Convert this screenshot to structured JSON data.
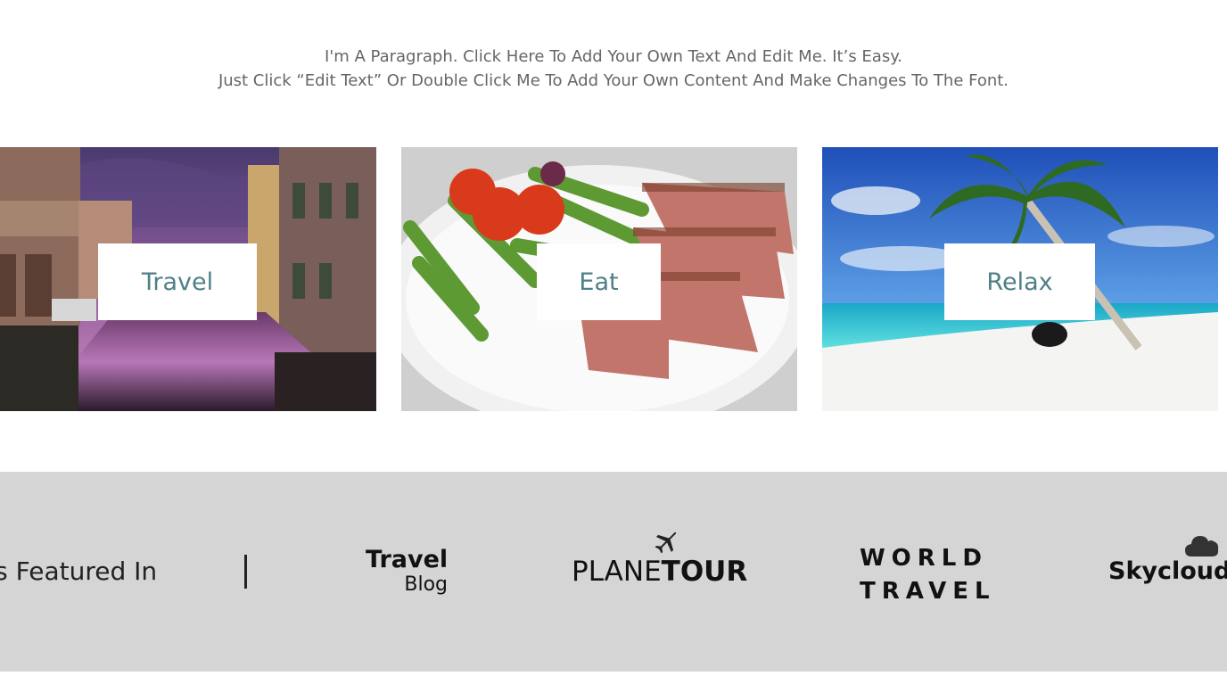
{
  "intro": {
    "line1": "I'm A Paragraph. Click Here To Add Your Own Text And Edit Me. It’s Easy.",
    "line2": "Just Click “Edit Text” Or Double Click Me To Add Your Own Content And Make Changes To The Font."
  },
  "cards": [
    {
      "label": "Travel",
      "image": "venice-canal-photo"
    },
    {
      "label": "Eat",
      "image": "steak-asparagus-plate-photo"
    },
    {
      "label": "Relax",
      "image": "tropical-beach-palm-photo"
    }
  ],
  "featured": {
    "heading": "As Featured In",
    "logos": {
      "travel_blog": {
        "line1": "Travel",
        "line2": "Blog"
      },
      "planetour": {
        "light": "PLANE",
        "bold": "TOUR",
        "icon": "airplane-icon"
      },
      "world_travel": {
        "line1": "WORLD",
        "line2": "TRAVEL"
      },
      "skycloud": {
        "text": "Skycloud",
        "icon": "cloud-icon"
      }
    }
  },
  "colors": {
    "card_label": "#4f7f87",
    "featured_bg": "#d5d5d5",
    "intro_text": "#666666"
  }
}
